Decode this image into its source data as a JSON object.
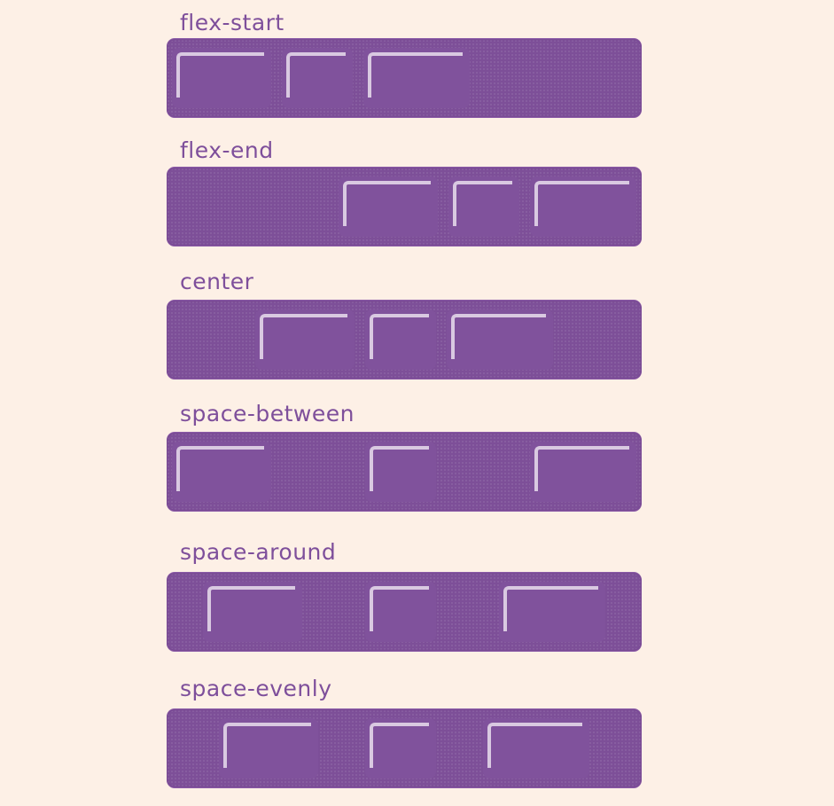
{
  "background_color": "#fdf0e6",
  "container_color": "#7d4f98",
  "label_color": "#7e4f9b",
  "sections": [
    {
      "label": "flex-start",
      "justify": "flex-start"
    },
    {
      "label": "flex-end",
      "justify": "flex-end"
    },
    {
      "label": "center",
      "justify": "center"
    },
    {
      "label": "space-between",
      "justify": "space-between"
    },
    {
      "label": "space-around",
      "justify": "space-around"
    },
    {
      "label": "space-evenly",
      "justify": "space-evenly"
    }
  ]
}
